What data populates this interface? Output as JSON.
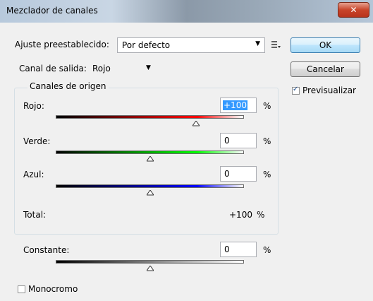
{
  "window": {
    "title": "Mezclador de canales",
    "close_glyph": "✕"
  },
  "preset": {
    "label": "Ajuste preestablecido:",
    "value": "Por defecto",
    "menu_icon": "preset-options-icon"
  },
  "output": {
    "label": "Canal de salida:",
    "value": "Rojo"
  },
  "buttons": {
    "ok": "OK",
    "cancel": "Cancelar"
  },
  "preview": {
    "label": "Previsualizar",
    "checked": true,
    "check_glyph": "✓"
  },
  "source": {
    "legend": "Canales de origen",
    "channels": [
      {
        "label": "Rojo:",
        "value": "+100",
        "level": 100,
        "color": "#ff0000"
      },
      {
        "label": "Verde:",
        "value": "0",
        "level": 0,
        "color": "#00ff00"
      },
      {
        "label": "Azul:",
        "value": "0",
        "level": 0,
        "color": "#0000ff"
      }
    ],
    "total_label": "Total:",
    "total_value": "+100",
    "percent": "%"
  },
  "constant": {
    "label": "Constante:",
    "value": "0",
    "level": 0,
    "percent": "%"
  },
  "monochrome": {
    "label": "Monocromo",
    "checked": false
  }
}
